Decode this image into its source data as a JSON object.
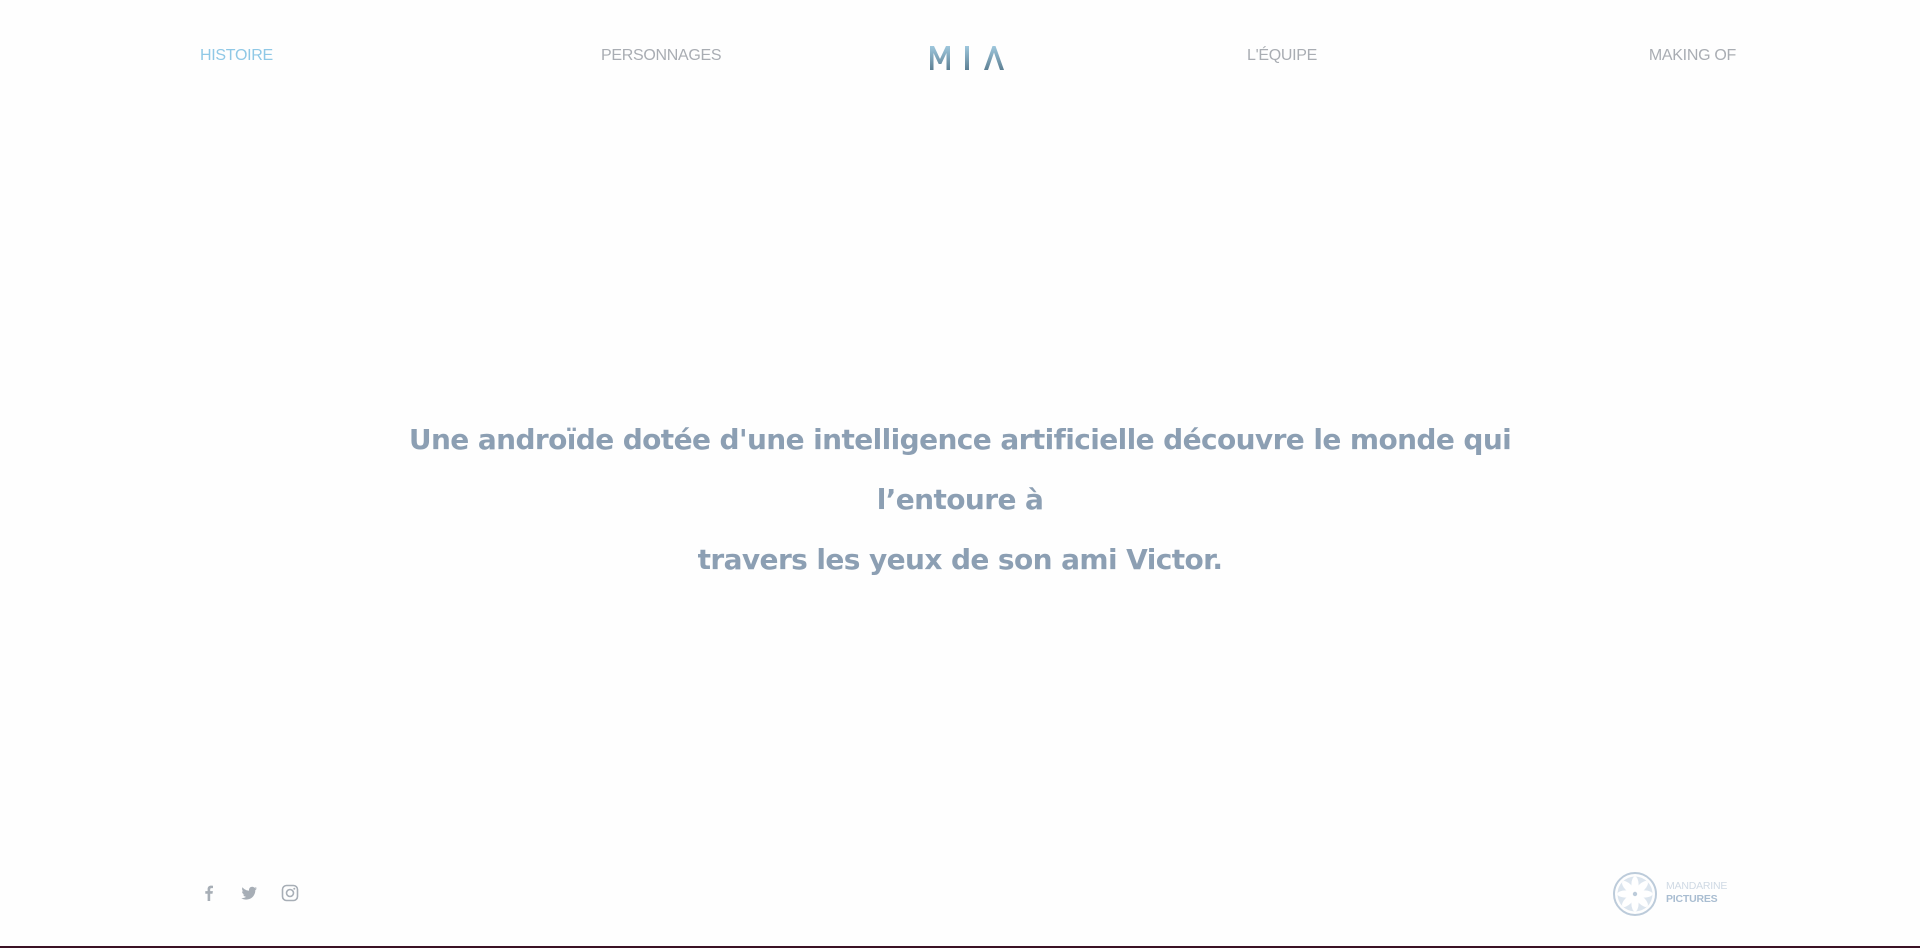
{
  "nav": {
    "histoire": "HISTOIRE",
    "personnages": "PERSONNAGES",
    "equipe": "L'ÉQUIPE",
    "making_of": "MAKING OF",
    "logo_text": "MIA"
  },
  "hero": {
    "line1": "Une androïde dotée d'une intelligence artificielle découvre le monde qui l’entoure à",
    "line2": "travers les yeux de son ami Victor."
  },
  "footer": {
    "social_icons": [
      "facebook-icon",
      "twitter-icon",
      "instagram-icon"
    ],
    "brand_line1": "MANDARINE",
    "brand_line2": "PICTURES"
  },
  "colors": {
    "background": "#fefefe",
    "nav_text": "#a9adb3",
    "nav_active": "#8fc8e6",
    "hero_text": "#8c9fb3",
    "logo_gradient_top": "#9ec7dd",
    "logo_gradient_bottom": "#5d7f93",
    "brand_light": "#cfd9e4",
    "brand_dark": "#a9bdd1",
    "bottom_strip": "#3b1224"
  }
}
